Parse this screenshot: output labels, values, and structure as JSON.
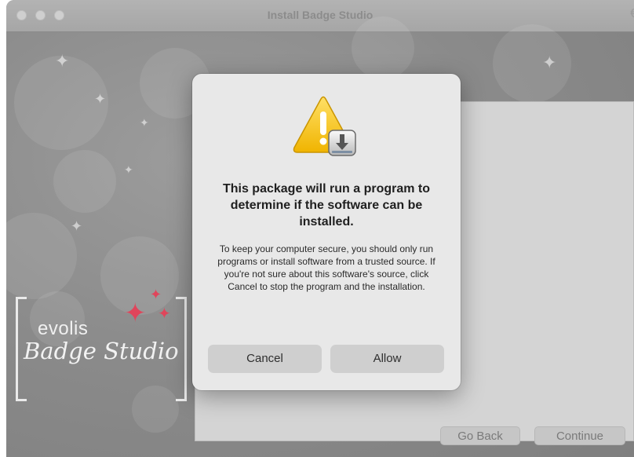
{
  "window": {
    "title": "Install Badge Studio",
    "title_glyph": "€"
  },
  "logo": {
    "brand": "evolis",
    "product": "Badge Studio"
  },
  "navigation": {
    "go_back_label": "Go Back",
    "continue_label": "Continue"
  },
  "dialog": {
    "icon": "warning-installer-icon",
    "heading": "This package will run a program to determine if the software can be installed.",
    "body": "To keep your computer secure, you should only run programs or install software from a trusted source. If you're not sure about this software's source, click Cancel to stop the program and the installation.",
    "cancel_label": "Cancel",
    "allow_label": "Allow"
  },
  "colors": {
    "accent_star": "#e0455b",
    "warning_yellow": "#f5c400"
  }
}
